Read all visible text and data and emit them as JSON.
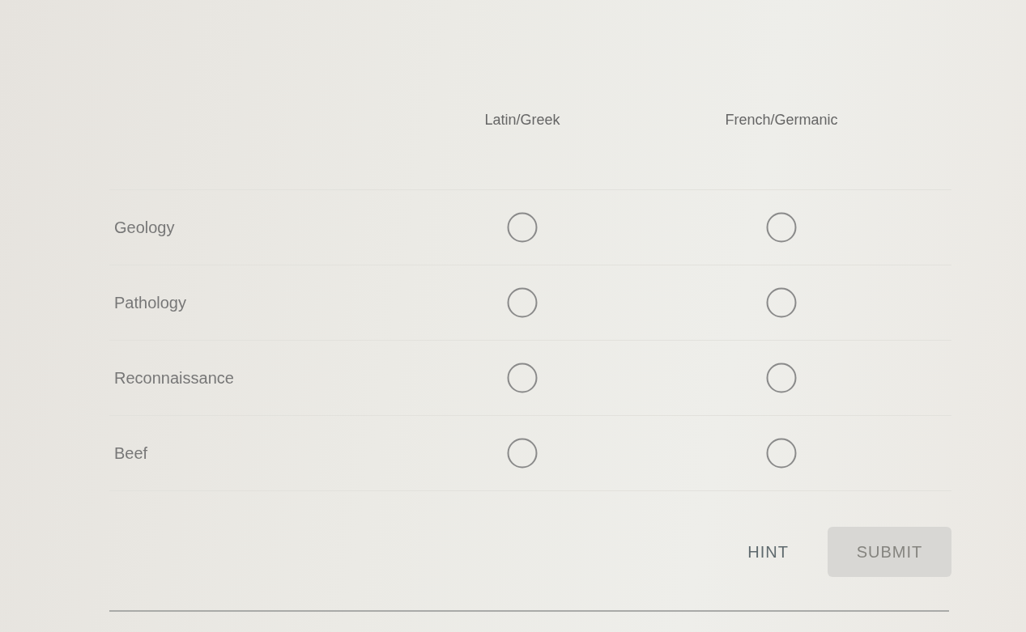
{
  "columns": [
    {
      "label": "Latin/Greek"
    },
    {
      "label": "French/Germanic"
    }
  ],
  "rows": [
    {
      "label": "Geology",
      "options": [
        {
          "selected": false
        },
        {
          "selected": false
        }
      ]
    },
    {
      "label": "Pathology",
      "options": [
        {
          "selected": false
        },
        {
          "selected": false
        }
      ]
    },
    {
      "label": "Reconnaissance",
      "options": [
        {
          "selected": false
        },
        {
          "selected": false
        }
      ]
    },
    {
      "label": "Beef",
      "options": [
        {
          "selected": false
        },
        {
          "selected": false
        }
      ]
    }
  ],
  "buttons": [
    {
      "label": "HINT",
      "kind": "text",
      "disabled": false
    },
    {
      "label": "SUBMIT",
      "kind": "filled",
      "disabled": true
    }
  ]
}
